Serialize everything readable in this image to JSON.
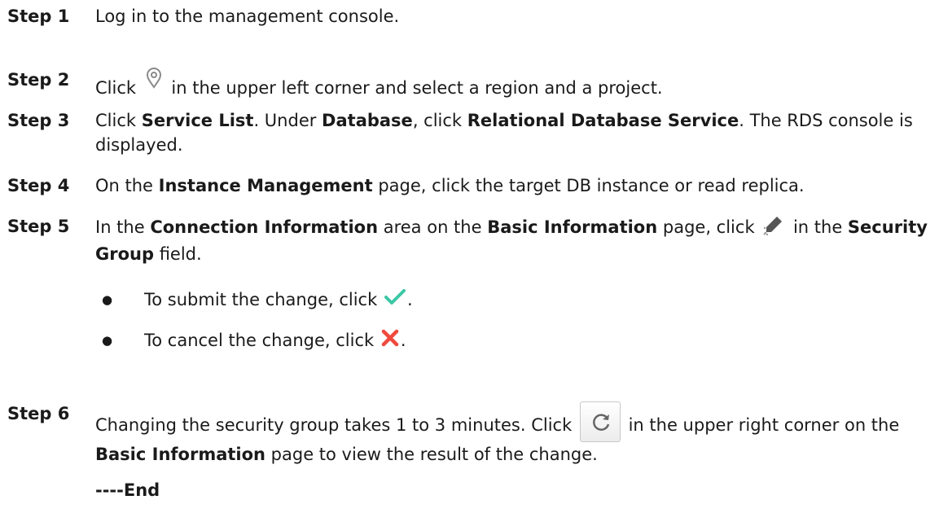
{
  "steps": [
    {
      "label": "Step 1",
      "text": "Log in to the management console."
    },
    {
      "label": "Step 2",
      "t1": "Click ",
      "t2": " in the upper left corner and select a region and a project."
    },
    {
      "label": "Step 3",
      "t1": "Click ",
      "b1": "Service List",
      "t2": ". Under ",
      "b2": "Database",
      "t3": ", click ",
      "b3": "Relational Database Service",
      "t4": ". The RDS console is displayed."
    },
    {
      "label": "Step 4",
      "t1": "On the ",
      "b1": "Instance Management",
      "t2": " page, click the target DB instance or read replica."
    },
    {
      "label": "Step 5",
      "t1": "In the ",
      "b1": "Connection Information",
      "t2": " area on the ",
      "b2": "Basic Information",
      "t3": " page, click ",
      "t4": " in the ",
      "b3": "Security Group",
      "t5": " field."
    },
    {
      "label": "Step 6",
      "t1": "Changing the security group takes 1 to 3 minutes. Click ",
      "t2": " in the upper right corner on the ",
      "b1": "Basic Information",
      "t3": " page to view the result of the change."
    }
  ],
  "bullets": [
    {
      "dot": "●",
      "text": "To submit the change, click ",
      "end": "."
    },
    {
      "dot": "●",
      "text": "To cancel the change, click ",
      "end": "."
    }
  ],
  "end_marker": "----End",
  "colors": {
    "check": "#3cc7a6",
    "cross": "#f0493d",
    "pin": "#8a8a8a",
    "pencil": "#555555",
    "refresh": "#666666"
  },
  "icons": [
    "location-pin-icon",
    "pencil-edit-icon",
    "checkmark-icon",
    "cross-icon",
    "refresh-icon"
  ]
}
